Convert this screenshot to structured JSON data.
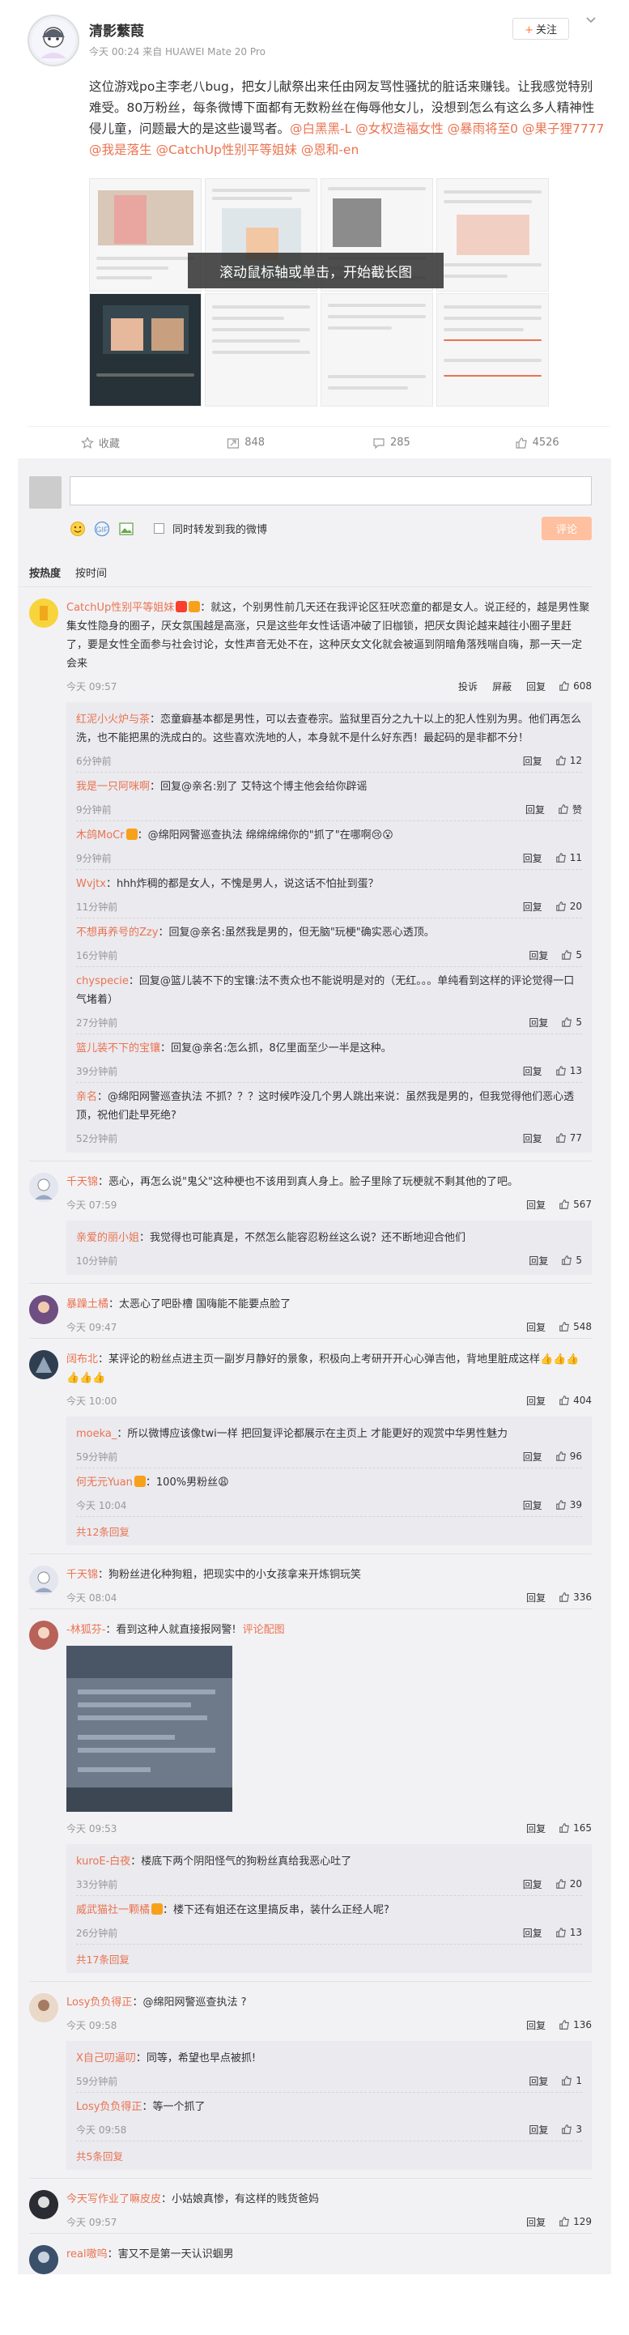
{
  "post": {
    "author": "清影蘩葭",
    "time": "今天 00:24 来自 HUAWEI Mate 20 Pro",
    "follow_label": "关注",
    "follow_plus": "+",
    "text_plain": "这位游戏po主李老八bug，把女儿献祭出来任由网友骂性骚扰的脏话来赚钱。让我感觉特别难受。80万粉丝，每条微博下面都有无数粉丝在侮辱他女儿，没想到怎么有这么多人精神性侵儿童，问题最大的是这些谩骂者。",
    "mentions": [
      "@白黑黑-L",
      "@女权造福女性",
      "@暴雨将至0",
      "@果子狸7777",
      "@我是落生",
      "@CatchUp性别平等姐妹",
      "@恩和-en"
    ],
    "overlay": "滚动鼠标轴或单击，开始截长图"
  },
  "actions": {
    "collect": "收藏",
    "forward": "848",
    "comment": "285",
    "like": "4526"
  },
  "composer": {
    "sync_label": "同时转发到我的微博",
    "submit": "评论"
  },
  "sort": {
    "hot": "按热度",
    "time": "按时间"
  },
  "comments": [
    {
      "user": "CatchUp性别平等姐妹",
      "text": "：就这，个别男性前几天还在我评论区狂吠恋童的都是女人。说正经的，越是男性聚集女性隐身的圈子，厌女氛围越是高涨，只是这些年女性话语冲破了旧枷锁，把厌女舆论越来越往小圈子里赶了，要是女性全面参与社会讨论，女性声音无处不在，这种厌女文化就会被逼到阴暗角落残喘自嗨，那一天一定会来",
      "time": "今天 09:57",
      "extra1": "投诉",
      "extra2": "屏蔽",
      "reply": "回复",
      "likes": "608",
      "replies": [
        {
          "user": "红泥小火炉与茶",
          "text": "：恋童癖基本都是男性，可以去查卷宗。监狱里百分之九十以上的犯人性别为男。他们再怎么洗，也不能把黑的洗成白的。这些喜欢洗地的人，本身就不是什么好东西！最起码的是非都不分！",
          "time": "6分钟前",
          "reply": "回复",
          "likes": "12"
        },
        {
          "user": "我是一只阿咪啊",
          "text": "：回复@亲名:别了 艾特这个博主他会给你辟谣",
          "time": "9分钟前",
          "reply": "回复",
          "likes": "赞"
        },
        {
          "user": "木鸽MoCr",
          "text": "：@绵阳网警巡查执法 绵绵绵绵你的\"抓了\"在哪啊😢😮",
          "time": "9分钟前",
          "reply": "回复",
          "likes": "11"
        },
        {
          "user": "Wvjtx",
          "text": "：hhh炸稠的都是女人，不愧是男人，说这话不怕扯到蛋？",
          "time": "11分钟前",
          "reply": "回复",
          "likes": "20"
        },
        {
          "user": "不想再养号的Zzy",
          "text": "：回复@亲名:虽然我是男的，但无脑\"玩梗\"确实恶心透顶。",
          "time": "16分钟前",
          "reply": "回复",
          "likes": "5"
        },
        {
          "user": "chyspecie",
          "text": "：回复@篮儿装不下的宝镶:法不责众也不能说明是对的（无红。。。单纯看到这样的评论觉得一口气堵着）",
          "time": "27分钟前",
          "reply": "回复",
          "likes": "5"
        },
        {
          "user": "篮儿装不下的宝镶",
          "text": "：回复@亲名:怎么抓，8亿里面至少一半是这种。",
          "time": "39分钟前",
          "reply": "回复",
          "likes": "13"
        },
        {
          "user": "亲名",
          "text": "：@绵阳网警巡查执法 不抓？？？这时候咋没几个男人跳出来说：虽然我是男的，但我觉得他们恶心透顶，祝他们赴早死绝?",
          "time": "52分钟前",
          "reply": "回复",
          "likes": "77"
        }
      ]
    },
    {
      "user": "千天锦",
      "text": "：恶心，再怎么说\"鬼父\"这种梗也不该用到真人身上。脸子里除了玩梗就不剩其他的了吧。",
      "time": "今天 07:59",
      "reply": "回复",
      "likes": "567",
      "replies": [
        {
          "user": "亲爱的丽小姐",
          "text": "：我觉得也可能真是，不然怎么能容忍粉丝这么说？还不断地迎合他们",
          "time": "10分钟前",
          "reply": "回复",
          "likes": "5"
        }
      ]
    },
    {
      "user": "暴躁土橘",
      "text": "：太恶心了吧卧槽 国嗨能不能要点脸了",
      "time": "今天 09:47",
      "reply": "回复",
      "likes": "548",
      "replies": []
    },
    {
      "user": "阔布北",
      "text": "：某评论的粉丝点进主页一副岁月静好的景象，积极向上考研开开心心弹吉他，背地里脏成这样👍👍👍👍👍👍",
      "time": "今天 10:00",
      "reply": "回复",
      "likes": "404",
      "replies": [
        {
          "user": "moeka_",
          "text": "：所以微博应该像twi一样 把回复评论都展示在主页上 才能更好的观赏中华男性魅力",
          "time": "59分钟前",
          "reply": "回复",
          "likes": "96"
        },
        {
          "user": "何无元Yuan",
          "text": "：100%男粉丝😩",
          "time": "今天 10:04",
          "reply": "回复",
          "likes": "39"
        }
      ],
      "more": "共12条回复"
    },
    {
      "user": "千天锦",
      "text": "：狗粉丝进化种狗粗，把现实中的小女孩拿来开炼铜玩笑",
      "time": "今天 08:04",
      "reply": "回复",
      "likes": "336",
      "replies": []
    },
    {
      "user": "-林狐芬-",
      "text": "：看到这种人就直接报网警!",
      "link": "评论配图",
      "time": "今天 09:53",
      "reply": "回复",
      "likes": "165",
      "replies": [
        {
          "user": "kuroE-白夜",
          "text": "：楼底下两个阴阳怪气的狗粉丝真给我恶心吐了",
          "time": "33分钟前",
          "reply": "回复",
          "likes": "20"
        },
        {
          "user": "威武猫社一颗橘",
          "text": "：楼下还有姐还在这里搞反串，装什么正经人呢?",
          "time": "26分钟前",
          "reply": "回复",
          "likes": "13"
        }
      ],
      "more": "共17条回复"
    },
    {
      "user": "Losy负负得正",
      "text": "：@绵阳网警巡查执法 ?",
      "time": "今天 09:58",
      "reply": "回复",
      "likes": "136",
      "replies": [
        {
          "user": "X自己叨逼叨",
          "text": "：同等，希望也早点被抓!",
          "time": "59分钟前",
          "reply": "回复",
          "likes": "1"
        },
        {
          "user": "Losy负负得正",
          "text": "：等一个抓了",
          "time": "今天 09:58",
          "reply": "回复",
          "likes": "3"
        }
      ],
      "more": "共5条回复"
    },
    {
      "user": "今天写作业了嘛皮皮",
      "text": "：小姑娘真惨，有这样的贱货爸妈",
      "time": "今天 09:57",
      "reply": "回复",
      "likes": "129",
      "replies": []
    },
    {
      "user": "real嗷呜",
      "text": "：害又不是第一天认识蝈男",
      "time": "",
      "reply": "",
      "likes": "",
      "replies": []
    }
  ],
  "colors": {
    "accent": "#eb7350",
    "panel": "#f2f2f5",
    "submit": "#ffc09f"
  },
  "icons": [
    "chevron-down-icon",
    "star-icon",
    "forward-icon",
    "comment-icon",
    "like-icon",
    "emoji-icon",
    "topic-icon",
    "image-icon"
  ]
}
